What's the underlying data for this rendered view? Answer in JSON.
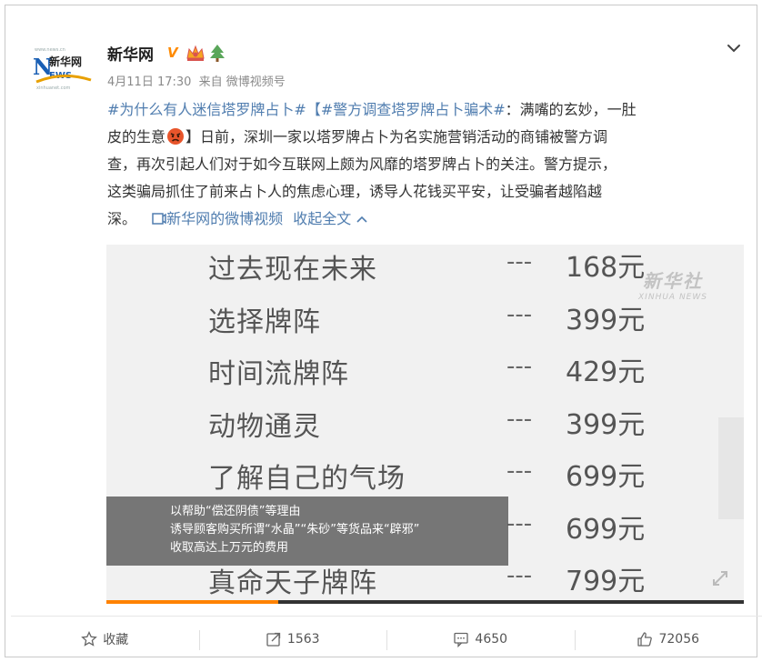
{
  "post": {
    "author": "新华网",
    "verified_badge": "V",
    "timestamp": "4月11日 17:30",
    "source": "来自 微博视频号",
    "tag1": "#为什么有人迷信塔罗牌占卜#",
    "tag2": "【#警方调查塔罗牌占卜骗术#",
    "line1_tail": "：满嘴的玄妙，一肚",
    "line2_head": "皮的生意",
    "line2_tail": "】日前，深圳一家以塔罗牌占卜为名实施营销活动的商铺被警方调",
    "line3": "查，再次引起人们对于如今互联网上颇为风靡的塔罗牌占卜的关注。警方提示，",
    "line4": "这类骗局抓住了前来占卜人的焦虑心理，诱导人花钱买平安，让受骗者越陷越",
    "line5_head": "深。",
    "video_link": "新华网的微博视频",
    "collapse": "收起全文"
  },
  "video": {
    "watermark_cn": "新华社",
    "watermark_en": "XINHUA NEWS",
    "rows": [
      {
        "item": "过去现在未来",
        "dash": "---",
        "price": "168元"
      },
      {
        "item": "选择牌阵",
        "dash": "---",
        "price": "399元"
      },
      {
        "item": "时间流牌阵",
        "dash": "---",
        "price": "429元"
      },
      {
        "item": "动物通灵",
        "dash": "---",
        "price": "399元"
      },
      {
        "item": "了解自己的气场",
        "dash": "---",
        "price": "699元"
      },
      {
        "item": "",
        "dash": "---",
        "price": "699元"
      },
      {
        "item": "真命天子牌阵",
        "dash": "---",
        "price": "799元"
      }
    ],
    "caption": [
      "以帮助“偿还阴债”等理由",
      "诱导顾客购买所谓“水晶”“朱砂”等货品来“辟邪”",
      "收取高达上万元的费用"
    ],
    "progress": 0.27
  },
  "actions": {
    "favorite": "收藏",
    "repost": "1563",
    "comment": "4650",
    "like": "72056"
  },
  "colors": {
    "link": "#507daf",
    "accent": "#ff8200"
  }
}
